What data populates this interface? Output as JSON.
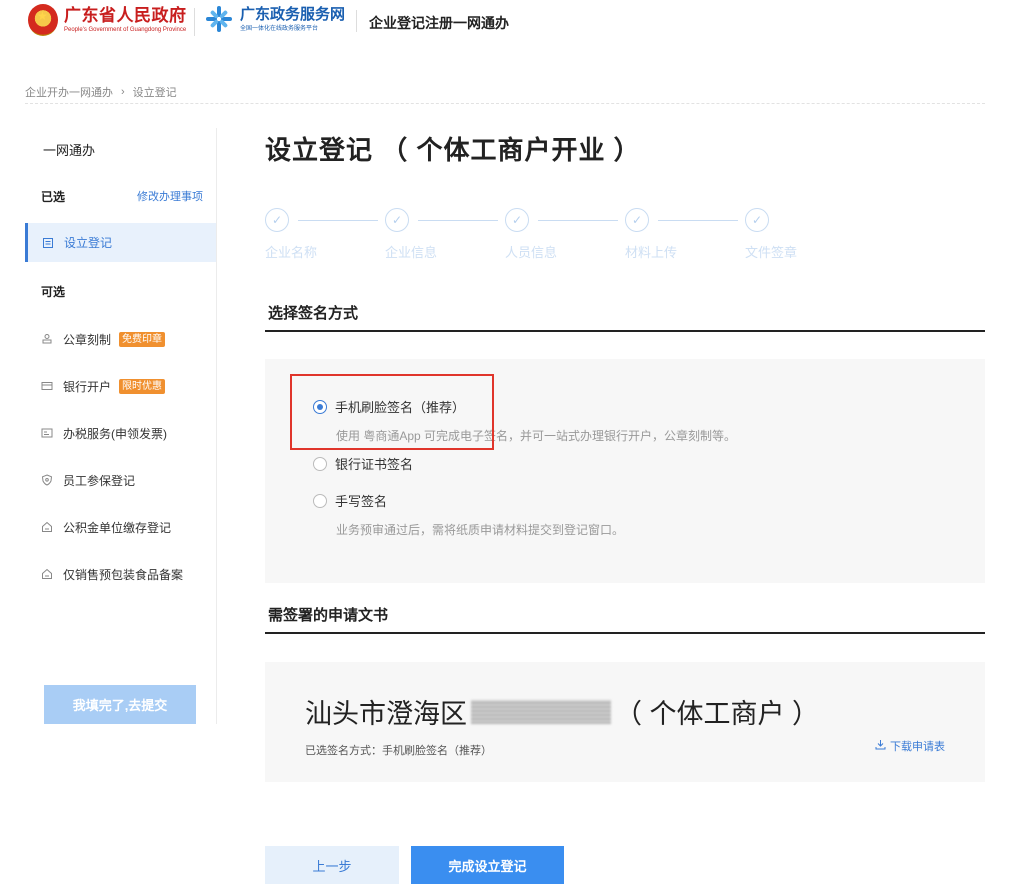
{
  "header": {
    "gov_name": "广东省人民政府",
    "gov_name_en": "People's Government of Guangdong Province",
    "service_name": "广东政务服务网",
    "service_tagline": "全国一体化在线政务服务平台",
    "title": "企业登记注册一网通办"
  },
  "breadcrumb": {
    "root": "企业开办一网通办",
    "separator": "›",
    "current": "设立登记"
  },
  "sidebar": {
    "title": "一网通办",
    "selected_label": "已选",
    "modify_link": "修改办理事项",
    "active_item": "设立登记",
    "optional_label": "可选",
    "items": [
      {
        "label": "公章刻制",
        "badge": "免费印章",
        "icon": "stamp-icon"
      },
      {
        "label": "银行开户",
        "badge": "限时优惠",
        "icon": "bank-card-icon"
      },
      {
        "label": "办税服务(申领发票)",
        "badge": "",
        "icon": "invoice-icon"
      },
      {
        "label": "员工参保登记",
        "badge": "",
        "icon": "shield-icon"
      },
      {
        "label": "公积金单位缴存登记",
        "badge": "",
        "icon": "house-icon"
      },
      {
        "label": "仅销售预包装食品备案",
        "badge": "",
        "icon": "house-icon"
      }
    ],
    "submit_label": "我填完了,去提交"
  },
  "main": {
    "title": "设立登记 （ 个体工商户开业 ）",
    "steps": [
      "企业名称",
      "企业信息",
      "人员信息",
      "材料上传",
      "文件签章"
    ],
    "sign_section": "选择签名方式",
    "options": {
      "face": "手机刷脸签名（推荐）",
      "face_hint": "使用 粤商通App 可完成电子签名，并可一站式办理银行开户，公章刻制等。",
      "cert": "银行证书签名",
      "hand": "手写签名",
      "hand_hint": "业务预审通过后，需将纸质申请材料提交到登记窗口。"
    },
    "docs_section": "需签署的申请文书",
    "doc": {
      "title_prefix": "汕头市澄海区",
      "title_suffix": "（ 个体工商户 ）",
      "selected_method": "已选签名方式：手机刷脸签名（推荐）",
      "download": "下载申请表"
    },
    "prev_button": "上一步",
    "done_button": "完成设立登记"
  },
  "colors": {
    "accent": "#3a7bd5",
    "badge": "#f0902f",
    "highlight": "#e0352b"
  }
}
